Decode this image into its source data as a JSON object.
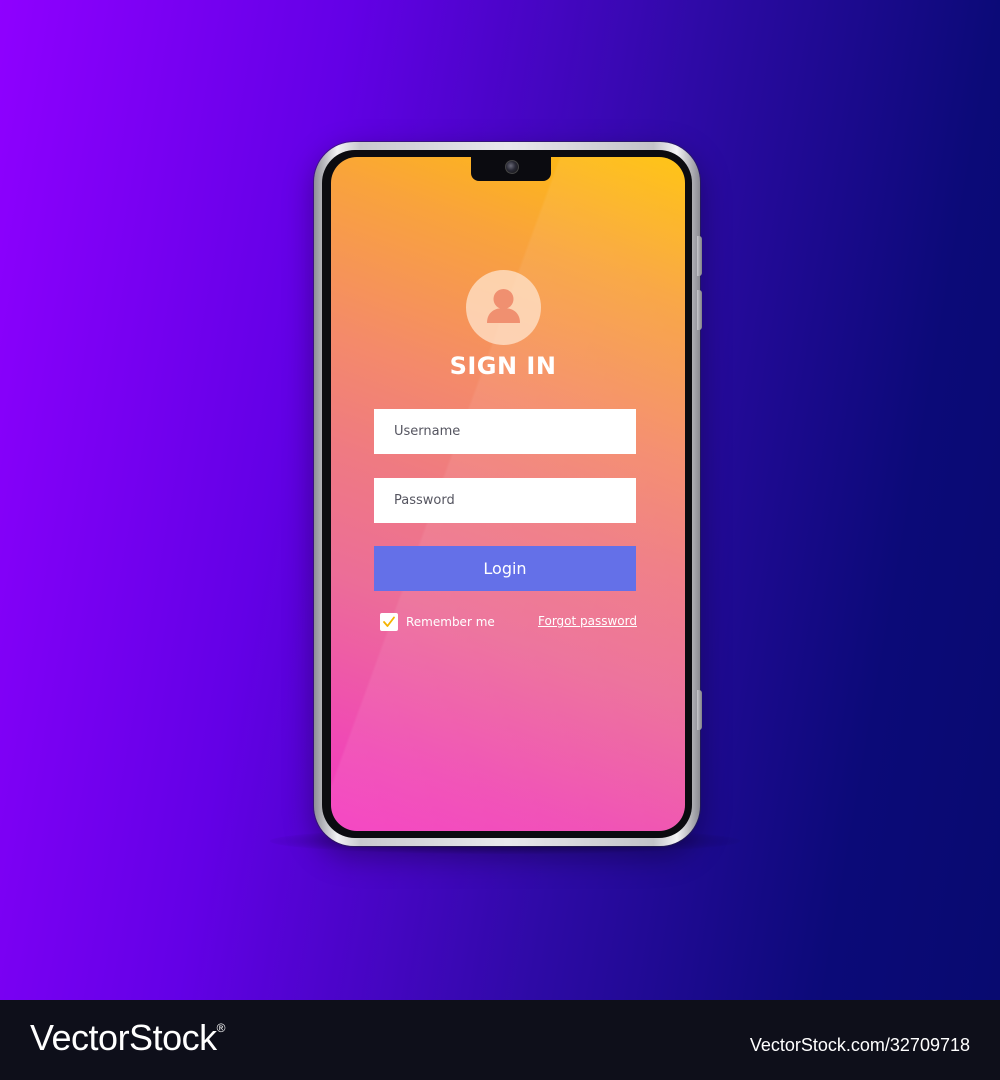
{
  "screen": {
    "title": "SIGN IN",
    "username": {
      "placeholder": "Username"
    },
    "password": {
      "placeholder": "Password"
    },
    "login_label": "Login",
    "remember_label": "Remember me",
    "remember_checked": true,
    "forgot_label": "Forgot password",
    "icons": {
      "avatar": "user-avatar-icon",
      "check": "checkmark-icon"
    }
  },
  "watermark": {
    "logo": "VectorStock",
    "registered": "®",
    "id": "VectorStock.com/32709718"
  },
  "colors": {
    "login_button": "#6470e8",
    "checkmark": "#f5b400",
    "background_left": "#8f00ff",
    "background_right": "#080a70"
  }
}
